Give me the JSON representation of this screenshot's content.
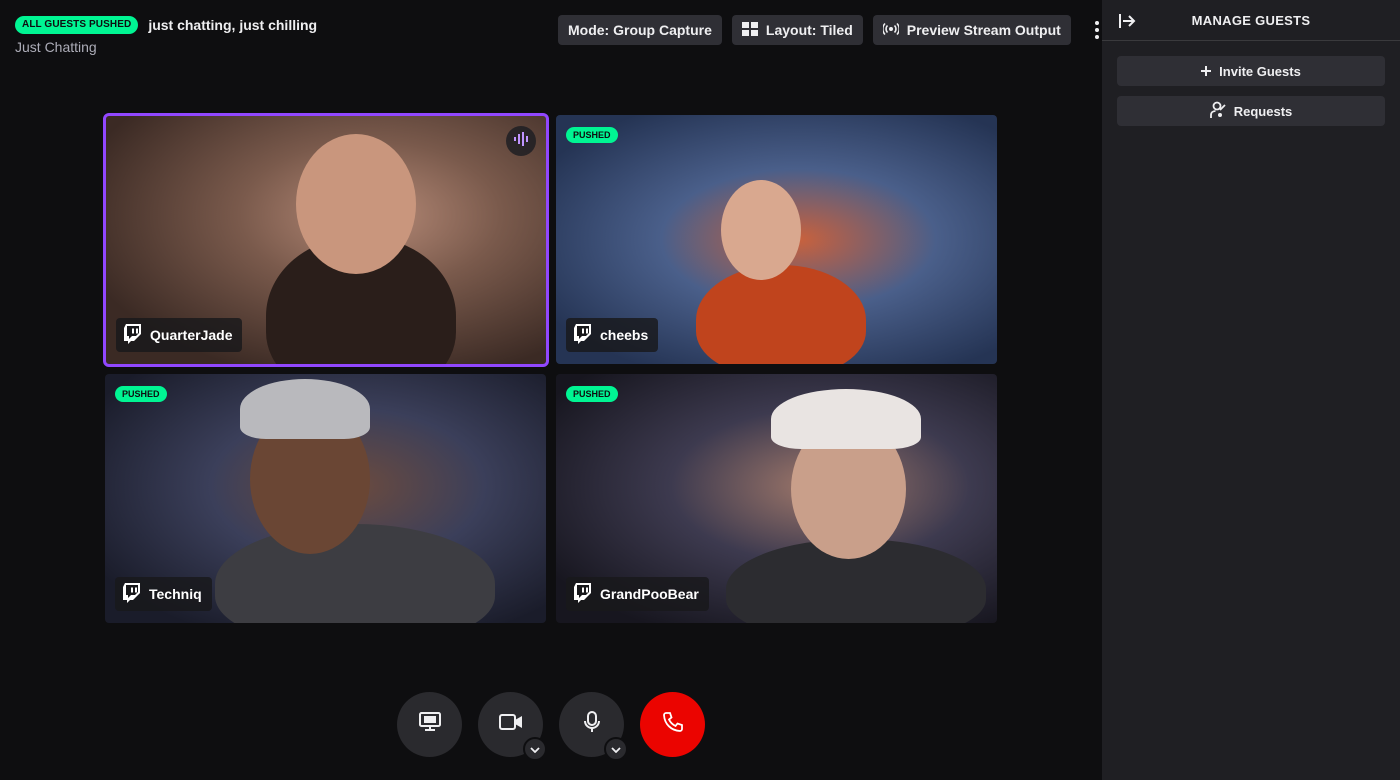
{
  "header": {
    "status_badge": "ALL GUESTS PUSHED",
    "stream_title": "just chatting, just chilling",
    "category": "Just Chatting",
    "mode_label": "Mode: Group Capture",
    "layout_label": "Layout: Tiled",
    "preview_label": "Preview Stream Output"
  },
  "guests": [
    {
      "name": "QuarterJade",
      "pushed": false,
      "speaking": true
    },
    {
      "name": "cheebs",
      "pushed": true,
      "badge": "PUSHED"
    },
    {
      "name": "Techniq",
      "pushed": true,
      "badge": "PUSHED"
    },
    {
      "name": "GrandPooBear",
      "pushed": true,
      "badge": "PUSHED"
    }
  ],
  "controls": [
    "screen-share",
    "camera",
    "microphone",
    "end-call"
  ],
  "sidebar": {
    "title": "MANAGE GUESTS",
    "invite_label": "Invite Guests",
    "requests_label": "Requests"
  },
  "colors": {
    "accent": "#9147ff",
    "pushed_green": "#00f593",
    "end_call_red": "#eb0400",
    "bg": "#0e0e10",
    "sidebar_bg": "#1f1f23"
  }
}
